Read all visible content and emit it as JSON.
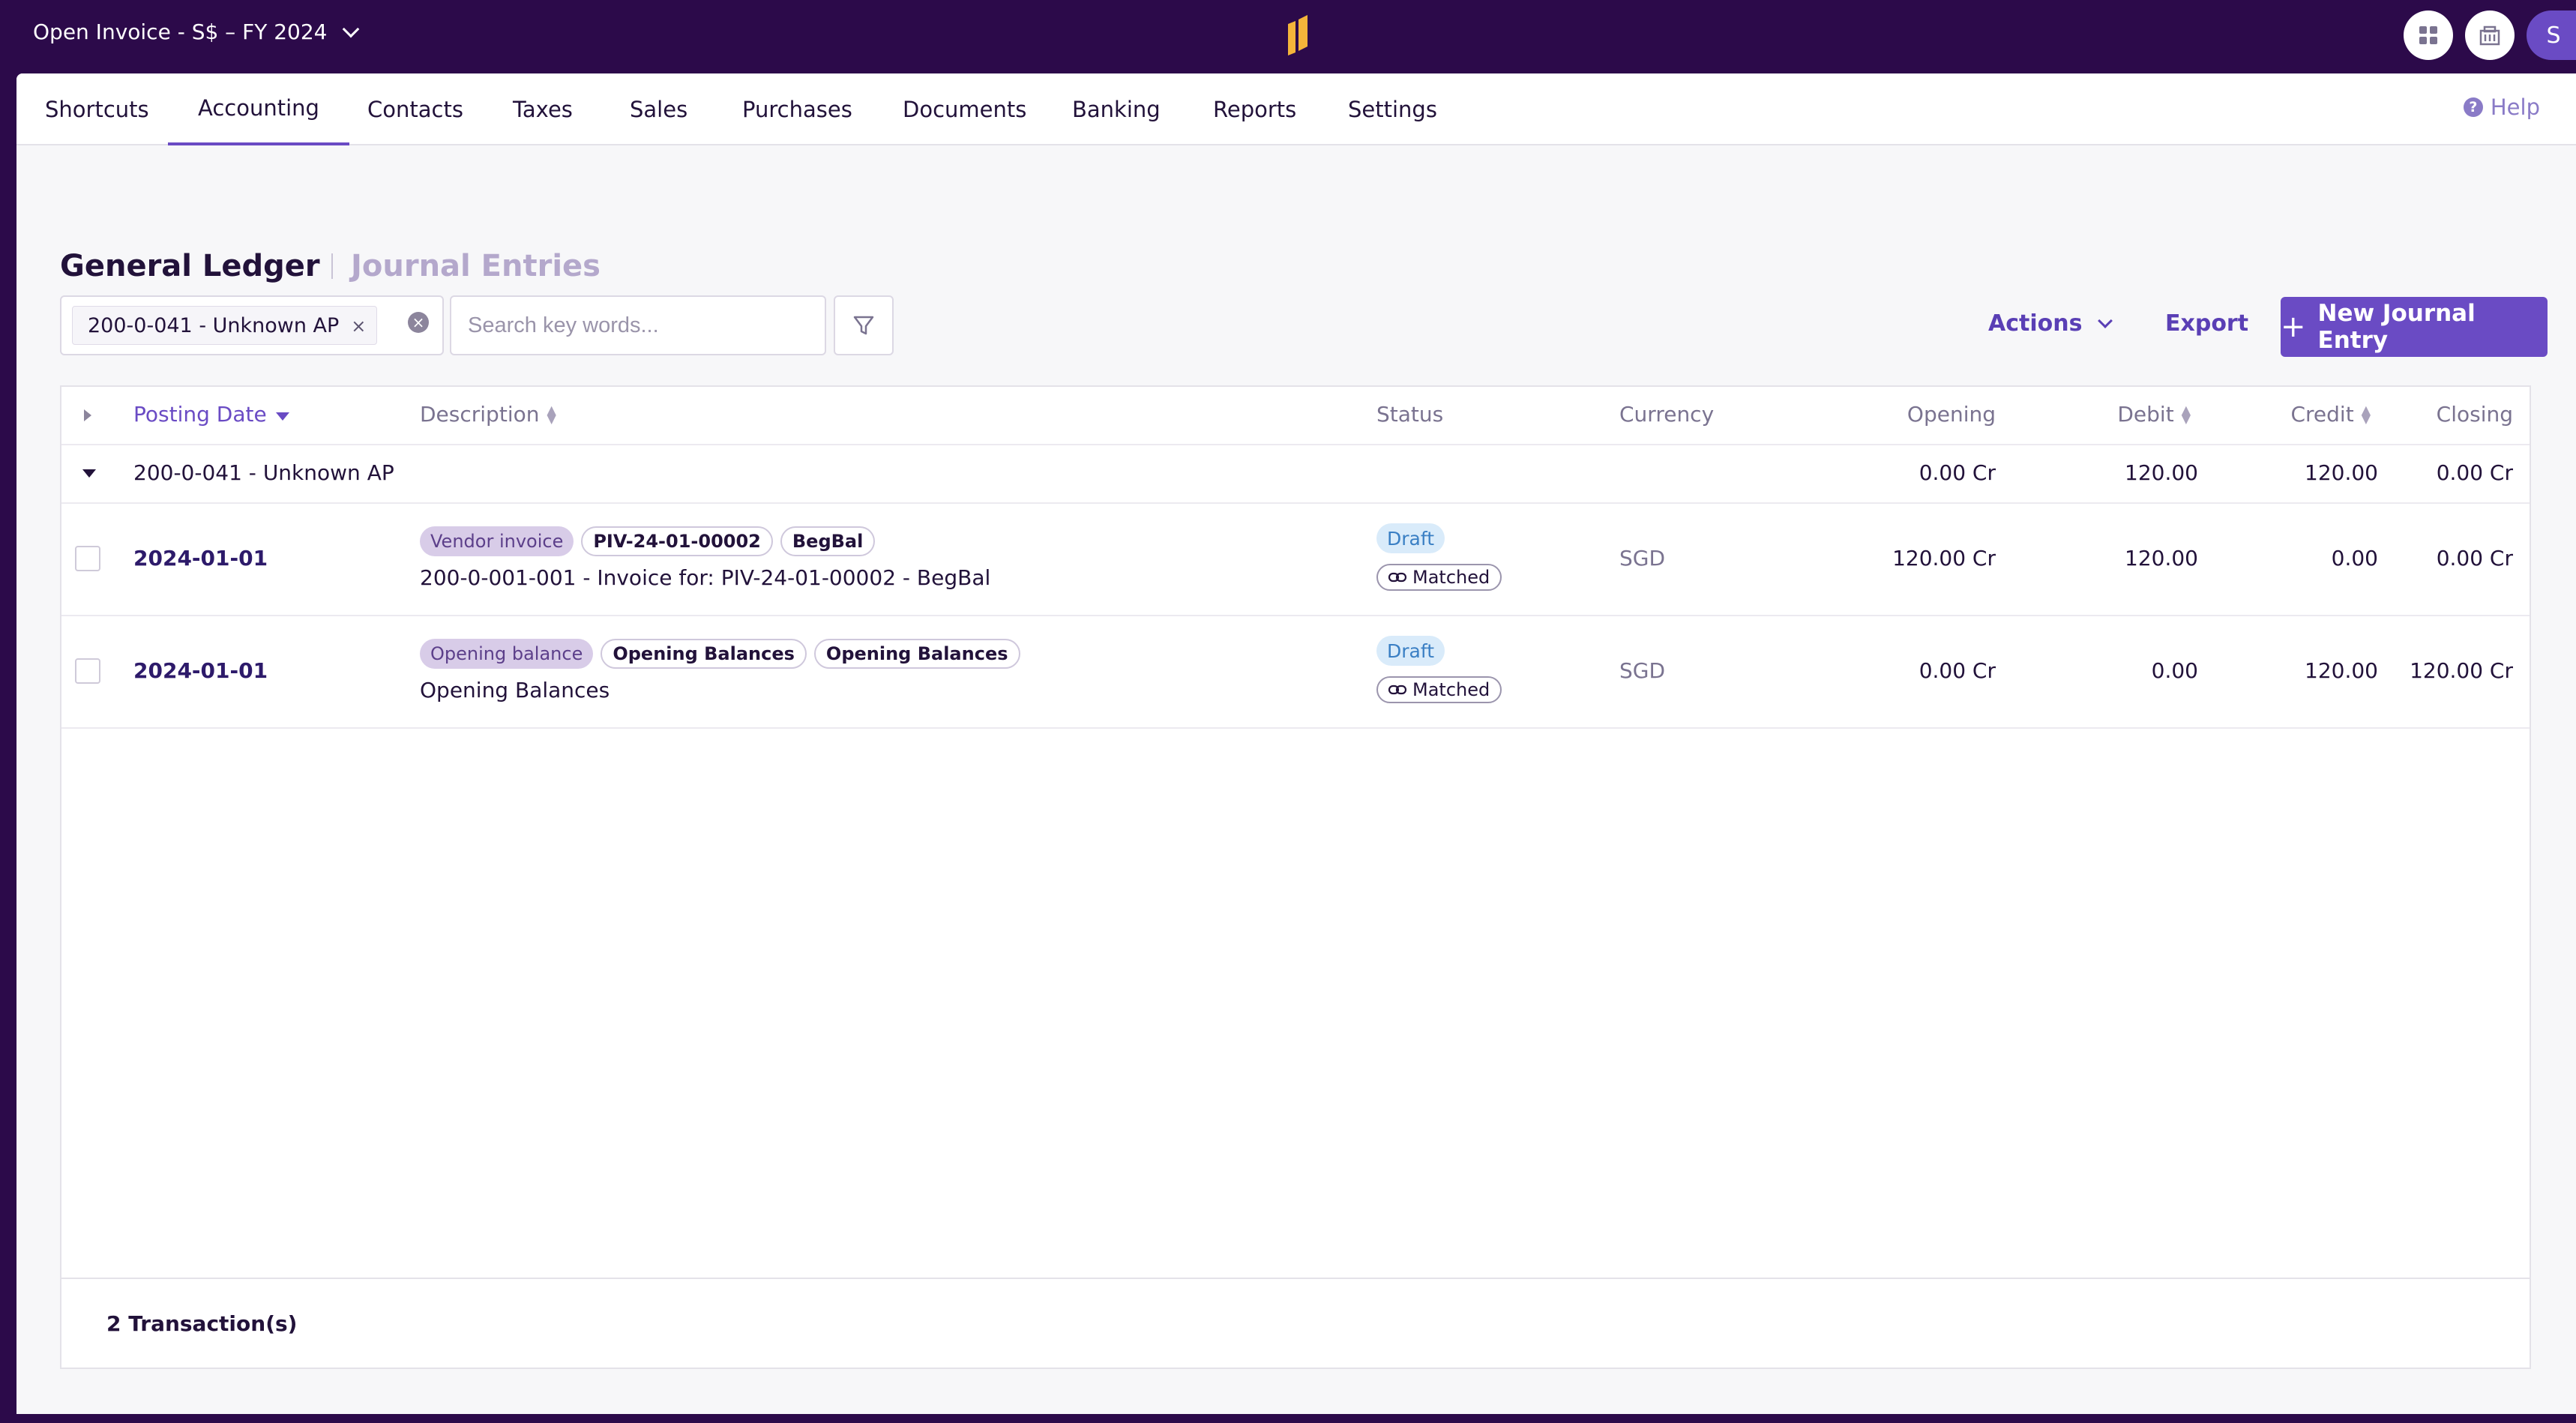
{
  "topbar": {
    "company": "Open Invoice - S$ – FY 2024",
    "logo": "brand-logo",
    "icons": [
      "apps-icon",
      "building-icon"
    ],
    "avatar_initial": "S"
  },
  "nav": {
    "items": [
      "Shortcuts",
      "Accounting",
      "Contacts",
      "Taxes",
      "Sales",
      "Purchases",
      "Documents",
      "Banking",
      "Reports",
      "Settings"
    ],
    "active": "Accounting",
    "help": "Help"
  },
  "page": {
    "title": "General Ledger",
    "alt_title": "Journal Entries"
  },
  "filter": {
    "chip": "200-0-041 - Unknown AP",
    "search_placeholder": "Search key words...",
    "actions_label": "Actions",
    "export_label": "Export",
    "new_entry_label": "New Journal Entry"
  },
  "table": {
    "headers": {
      "posting_date": "Posting Date",
      "description": "Description",
      "status": "Status",
      "currency": "Currency",
      "opening": "Opening",
      "debit": "Debit",
      "credit": "Credit",
      "closing": "Closing"
    },
    "group": {
      "name": "200-0-041 - Unknown AP",
      "opening": "0.00 Cr",
      "debit": "120.00",
      "credit": "120.00",
      "closing": "0.00 Cr"
    },
    "rows": [
      {
        "date": "2024-01-01",
        "type_tag": "Vendor invoice",
        "ref_tags": [
          "PIV-24-01-00002",
          "BegBal"
        ],
        "description": "200-0-001-001 - Invoice for: PIV-24-01-00002 - BegBal",
        "status": "Draft",
        "match": "Matched",
        "currency": "SGD",
        "opening": "120.00 Cr",
        "debit": "120.00",
        "credit": "0.00",
        "closing": "0.00 Cr"
      },
      {
        "date": "2024-01-01",
        "type_tag": "Opening balance",
        "ref_tags": [
          "Opening Balances",
          "Opening Balances"
        ],
        "description": "Opening Balances",
        "status": "Draft",
        "match": "Matched",
        "currency": "SGD",
        "opening": "0.00 Cr",
        "debit": "0.00",
        "credit": "120.00",
        "closing": "120.00 Cr"
      }
    ],
    "footer": "2 Transaction(s)"
  },
  "colors": {
    "brand": "#2c0a4a",
    "accent": "#6a4bc4",
    "draft": "#3a7fc4"
  }
}
